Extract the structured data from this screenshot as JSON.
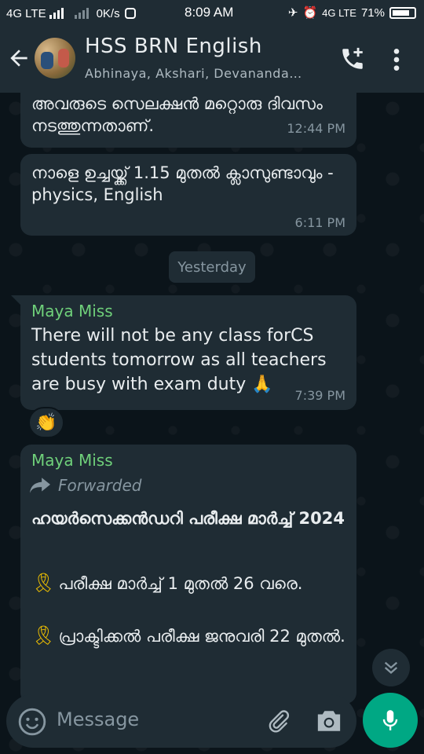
{
  "status_bar": {
    "left_network": "4G LTE",
    "speed": "0K/s",
    "time": "8:09 AM",
    "right_network": "4G LTE",
    "battery": "71%"
  },
  "header": {
    "title": "HSS BRN English",
    "subtitle": "Abhinaya, Akshari, Devananda…"
  },
  "messages": [
    {
      "text": "അവരുടെ സെലക്ഷൻ മറ്റൊരു ദിവസം നടത്തുന്നതാണ്.",
      "time": "12:44 PM"
    },
    {
      "text": "നാളെ ഉച്ചയ്ക്ക് 1.15 മുതൽ ക്ലാസുണ്ടാവും -physics, English",
      "time": "6:11 PM"
    },
    {
      "sender": "Maya Miss",
      "text": "There will not be any class forCS students tomorrow as all teachers are busy with exam duty 🙏",
      "time": "7:39 PM",
      "reaction": "👏"
    },
    {
      "sender": "Maya Miss",
      "forwarded_label": "Forwarded",
      "heading": "ഹയർസെക്കൻഡറി പരീക്ഷ മാർച്ച് 2024",
      "line1": "പരീക്ഷ മാർച്ച് 1 മുതൽ 26 വരെ.",
      "line2": "പ്രാക്ടിക്കൽ പരീക്ഷ ജനുവരി 22 മുതൽ."
    }
  ],
  "day_divider": "Yesterday",
  "input": {
    "placeholder": "Message"
  },
  "colors": {
    "accent": "#00a884",
    "sender": "#6fd07a",
    "bubble": "#1f2c34",
    "background": "#0b141a"
  }
}
